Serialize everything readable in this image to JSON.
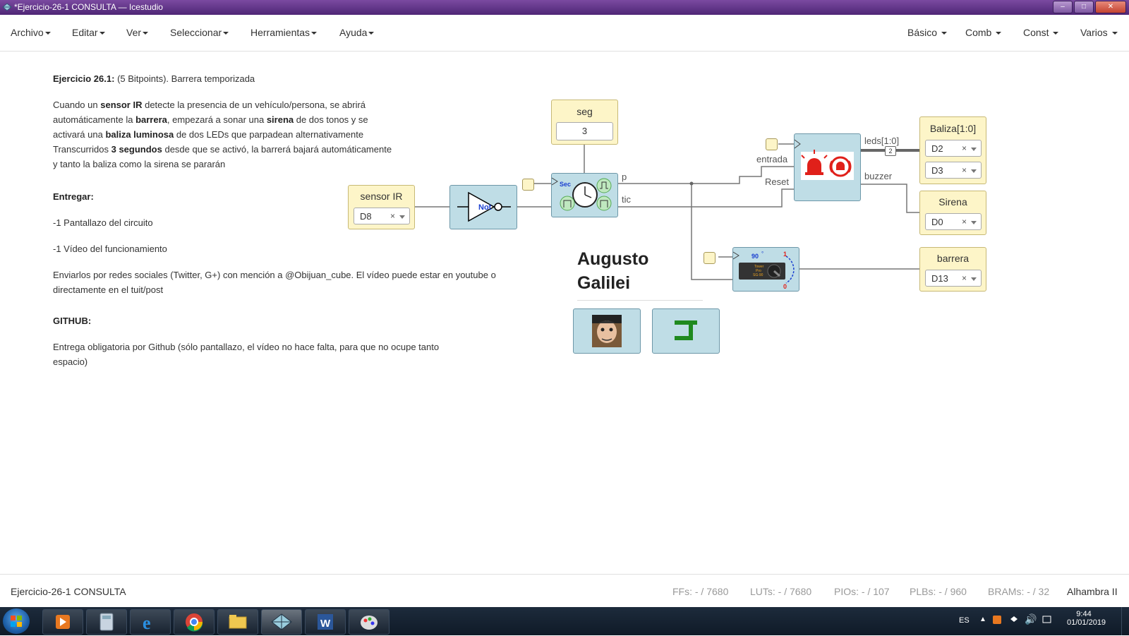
{
  "window": {
    "title": "*Ejercicio-26-1 CONSULTA — Icestudio",
    "buttons": [
      "–",
      "□",
      "✕"
    ]
  },
  "menubar": {
    "left": [
      "Archivo",
      "Editar",
      "Ver",
      "Seleccionar",
      "Herramientas",
      "Ayuda"
    ],
    "right": [
      "Básico",
      "Comb",
      "Const",
      "Varios"
    ]
  },
  "doc": {
    "heading_bold": "Ejercicio 26.1:",
    "heading_rest": " (5 Bitpoints). Barrera temporizada",
    "p1": [
      [
        "Cuando un ",
        "sensor IR",
        " detecte la presencia de un vehículo/persona, se abrirá"
      ],
      [
        "automáticamente la ",
        "barrera",
        ", empezará a sonar una ",
        "sirena",
        " de dos tonos y se"
      ],
      [
        "activará una ",
        "baliza luminosa",
        " de dos LEDs que parpadean alternativamente"
      ],
      [
        "Transcurridos ",
        "3 segundos",
        " desde que se activó, la barrerá bajará automáticamente"
      ],
      [
        "y tanto la baliza como la sirena se pararán"
      ]
    ],
    "entregar": "Entregar:",
    "item1": "-1 Pantallazo del circuito",
    "item2": "-1 Vídeo del funcionamiento",
    "enviar1": "Enviarlos por redes sociales (Twitter, G+) con mención a @Obijuan_cube. El vídeo puede estar en youtube o",
    "enviar2": "directamente en el tuit/post",
    "github": "GITHUB:",
    "github1": "Entrega obligatoria por Github (sólo pantallazo, el vídeo no hace falta, para que no ocupe tanto",
    "github2": "espacio)"
  },
  "circuit": {
    "sensor": {
      "label": "sensor IR",
      "pin": "D8",
      "clear": "×"
    },
    "not_gate": {
      "label": "Not"
    },
    "seg": {
      "label": "seg",
      "value": "3"
    },
    "timer": {
      "label": "Sec",
      "out_p": "p",
      "out_tic": "tic"
    },
    "alarm": {
      "in_entrada": "entrada",
      "in_reset": "Reset",
      "out_leds": "leds[1:0]",
      "out_buzzer": "buzzer",
      "bus_width": "2"
    },
    "baliza": {
      "label": "Baliza[1:0]",
      "pins": [
        "D2",
        "D3"
      ]
    },
    "sirena": {
      "label": "Sirena",
      "pin": "D0"
    },
    "servo": {
      "angle": "90",
      "degree": "°",
      "one": "1",
      "zero": "0",
      "brand1": "Tower",
      "brand2": "Pro",
      "model": "SG-90"
    },
    "barrera": {
      "label": "barrera",
      "pin": "D13"
    },
    "author": {
      "line1": "Augusto",
      "line2": "Galilei"
    },
    "wire_colors": {
      "wire": "#777777",
      "bus": "#666666"
    }
  },
  "statusbar": {
    "project": "Ejercicio-26-1 CONSULTA",
    "ffs": "FFs:  - / 7680",
    "luts": "LUTs:  - / 7680",
    "pios": "PIOs:  - / 107",
    "plbs": "PLBs:  - / 960",
    "brams": "BRAMs:  - / 32",
    "board": "Alhambra II"
  },
  "taskbar": {
    "lang": "ES",
    "time": "9:44",
    "date": "01/01/2019",
    "apps": [
      "media-player-icon",
      "calculator-icon",
      "internet-explorer-icon",
      "chrome-icon",
      "file-explorer-icon",
      "icestudio-icon",
      "word-icon",
      "paint-icon"
    ]
  }
}
